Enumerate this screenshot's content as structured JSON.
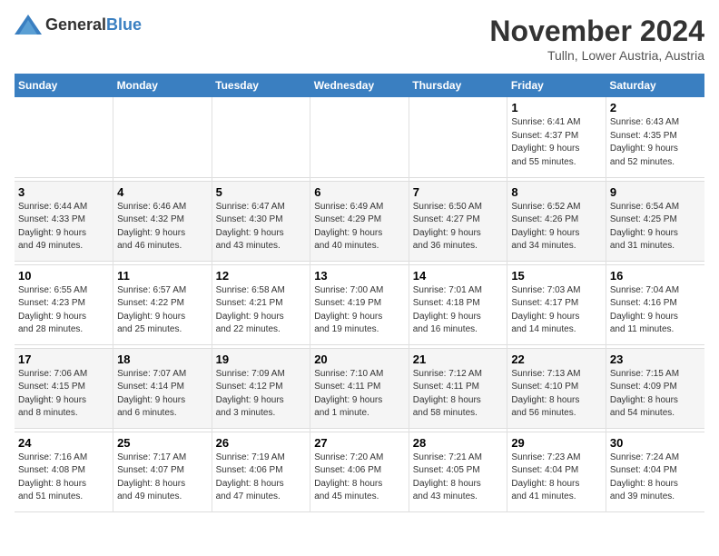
{
  "logo": {
    "general": "General",
    "blue": "Blue"
  },
  "title": "November 2024",
  "subtitle": "Tulln, Lower Austria, Austria",
  "weekdays": [
    "Sunday",
    "Monday",
    "Tuesday",
    "Wednesday",
    "Thursday",
    "Friday",
    "Saturday"
  ],
  "weeks": [
    [
      {
        "day": "",
        "info": ""
      },
      {
        "day": "",
        "info": ""
      },
      {
        "day": "",
        "info": ""
      },
      {
        "day": "",
        "info": ""
      },
      {
        "day": "",
        "info": ""
      },
      {
        "day": "1",
        "info": "Sunrise: 6:41 AM\nSunset: 4:37 PM\nDaylight: 9 hours\nand 55 minutes."
      },
      {
        "day": "2",
        "info": "Sunrise: 6:43 AM\nSunset: 4:35 PM\nDaylight: 9 hours\nand 52 minutes."
      }
    ],
    [
      {
        "day": "3",
        "info": "Sunrise: 6:44 AM\nSunset: 4:33 PM\nDaylight: 9 hours\nand 49 minutes."
      },
      {
        "day": "4",
        "info": "Sunrise: 6:46 AM\nSunset: 4:32 PM\nDaylight: 9 hours\nand 46 minutes."
      },
      {
        "day": "5",
        "info": "Sunrise: 6:47 AM\nSunset: 4:30 PM\nDaylight: 9 hours\nand 43 minutes."
      },
      {
        "day": "6",
        "info": "Sunrise: 6:49 AM\nSunset: 4:29 PM\nDaylight: 9 hours\nand 40 minutes."
      },
      {
        "day": "7",
        "info": "Sunrise: 6:50 AM\nSunset: 4:27 PM\nDaylight: 9 hours\nand 36 minutes."
      },
      {
        "day": "8",
        "info": "Sunrise: 6:52 AM\nSunset: 4:26 PM\nDaylight: 9 hours\nand 34 minutes."
      },
      {
        "day": "9",
        "info": "Sunrise: 6:54 AM\nSunset: 4:25 PM\nDaylight: 9 hours\nand 31 minutes."
      }
    ],
    [
      {
        "day": "10",
        "info": "Sunrise: 6:55 AM\nSunset: 4:23 PM\nDaylight: 9 hours\nand 28 minutes."
      },
      {
        "day": "11",
        "info": "Sunrise: 6:57 AM\nSunset: 4:22 PM\nDaylight: 9 hours\nand 25 minutes."
      },
      {
        "day": "12",
        "info": "Sunrise: 6:58 AM\nSunset: 4:21 PM\nDaylight: 9 hours\nand 22 minutes."
      },
      {
        "day": "13",
        "info": "Sunrise: 7:00 AM\nSunset: 4:19 PM\nDaylight: 9 hours\nand 19 minutes."
      },
      {
        "day": "14",
        "info": "Sunrise: 7:01 AM\nSunset: 4:18 PM\nDaylight: 9 hours\nand 16 minutes."
      },
      {
        "day": "15",
        "info": "Sunrise: 7:03 AM\nSunset: 4:17 PM\nDaylight: 9 hours\nand 14 minutes."
      },
      {
        "day": "16",
        "info": "Sunrise: 7:04 AM\nSunset: 4:16 PM\nDaylight: 9 hours\nand 11 minutes."
      }
    ],
    [
      {
        "day": "17",
        "info": "Sunrise: 7:06 AM\nSunset: 4:15 PM\nDaylight: 9 hours\nand 8 minutes."
      },
      {
        "day": "18",
        "info": "Sunrise: 7:07 AM\nSunset: 4:14 PM\nDaylight: 9 hours\nand 6 minutes."
      },
      {
        "day": "19",
        "info": "Sunrise: 7:09 AM\nSunset: 4:12 PM\nDaylight: 9 hours\nand 3 minutes."
      },
      {
        "day": "20",
        "info": "Sunrise: 7:10 AM\nSunset: 4:11 PM\nDaylight: 9 hours\nand 1 minute."
      },
      {
        "day": "21",
        "info": "Sunrise: 7:12 AM\nSunset: 4:11 PM\nDaylight: 8 hours\nand 58 minutes."
      },
      {
        "day": "22",
        "info": "Sunrise: 7:13 AM\nSunset: 4:10 PM\nDaylight: 8 hours\nand 56 minutes."
      },
      {
        "day": "23",
        "info": "Sunrise: 7:15 AM\nSunset: 4:09 PM\nDaylight: 8 hours\nand 54 minutes."
      }
    ],
    [
      {
        "day": "24",
        "info": "Sunrise: 7:16 AM\nSunset: 4:08 PM\nDaylight: 8 hours\nand 51 minutes."
      },
      {
        "day": "25",
        "info": "Sunrise: 7:17 AM\nSunset: 4:07 PM\nDaylight: 8 hours\nand 49 minutes."
      },
      {
        "day": "26",
        "info": "Sunrise: 7:19 AM\nSunset: 4:06 PM\nDaylight: 8 hours\nand 47 minutes."
      },
      {
        "day": "27",
        "info": "Sunrise: 7:20 AM\nSunset: 4:06 PM\nDaylight: 8 hours\nand 45 minutes."
      },
      {
        "day": "28",
        "info": "Sunrise: 7:21 AM\nSunset: 4:05 PM\nDaylight: 8 hours\nand 43 minutes."
      },
      {
        "day": "29",
        "info": "Sunrise: 7:23 AM\nSunset: 4:04 PM\nDaylight: 8 hours\nand 41 minutes."
      },
      {
        "day": "30",
        "info": "Sunrise: 7:24 AM\nSunset: 4:04 PM\nDaylight: 8 hours\nand 39 minutes."
      }
    ]
  ]
}
